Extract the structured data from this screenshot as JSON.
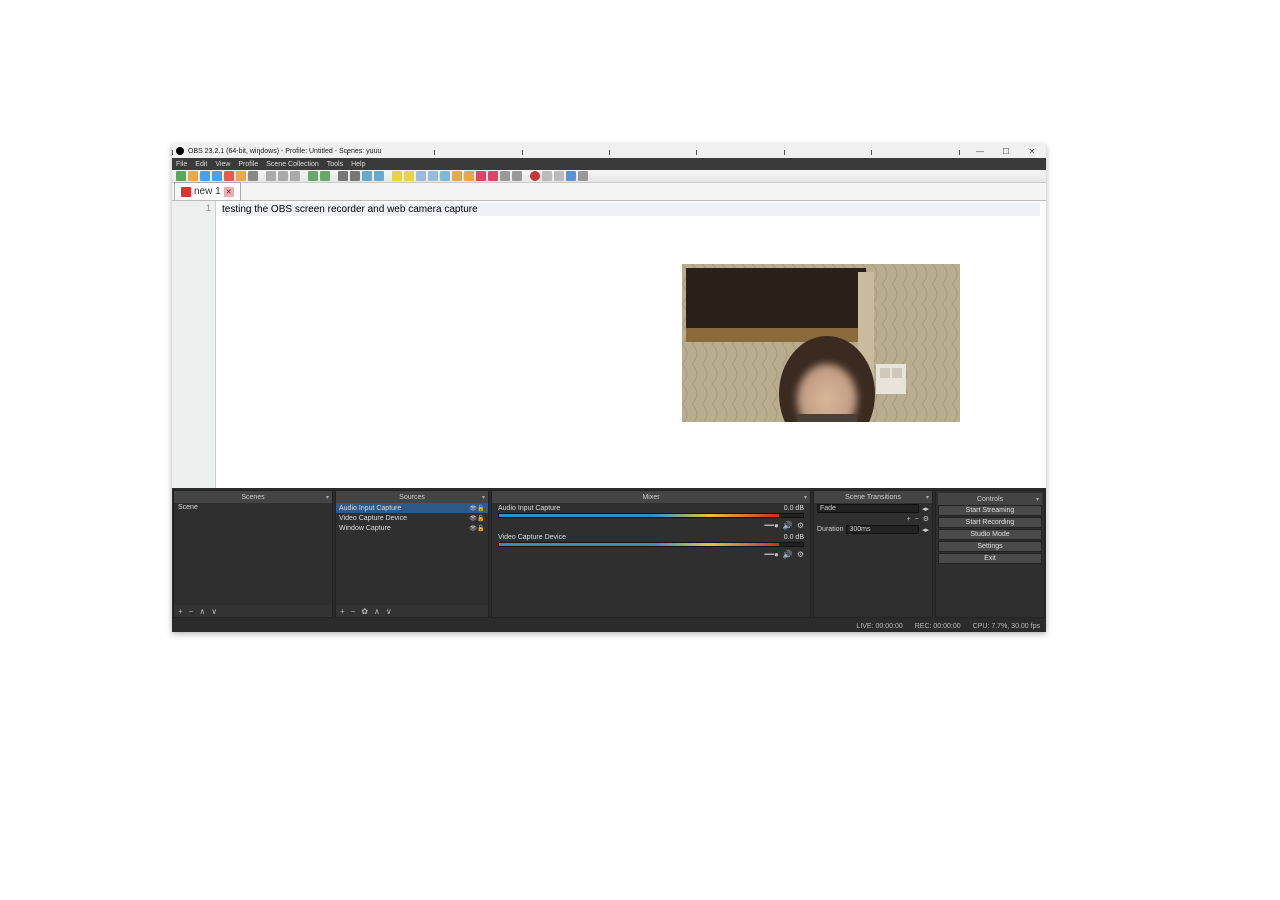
{
  "titlebar": {
    "title": "OBS 23.2.1 (64-bit, windows) - Profile: Untitled - Scenes: yuuu"
  },
  "menus": [
    "File",
    "Edit",
    "View",
    "Profile",
    "Scene Collection",
    "Tools",
    "Help"
  ],
  "editor": {
    "tab_name": "new 1",
    "line_number": "1",
    "line_text": "testing the OBS screen recorder and web camera capture"
  },
  "docks": {
    "scenes": {
      "header": "Scenes",
      "items": [
        "Scene"
      ]
    },
    "sources": {
      "header": "Sources",
      "items": [
        {
          "name": "Audio Input Capture",
          "selected": true
        },
        {
          "name": "Video Capture Device",
          "selected": false
        },
        {
          "name": "Window Capture",
          "selected": false
        }
      ]
    },
    "mixer": {
      "header": "Mixer",
      "channels": [
        {
          "name": "Audio Input Capture",
          "level": "0.0 dB"
        },
        {
          "name": "Video Capture Device",
          "level": "0.0 dB"
        }
      ]
    },
    "transitions": {
      "header": "Scene Transitions",
      "type": "Fade",
      "duration_label": "Duration",
      "duration_value": "300ms"
    },
    "controls": {
      "header": "Controls",
      "buttons": [
        "Start Streaming",
        "Start Recording",
        "Studio Mode",
        "Settings",
        "Exit"
      ]
    }
  },
  "statusbar": {
    "live": "LIVE: 00:00:00",
    "rec": "REC: 00:00:00",
    "cpu": "CPU: 7.7%, 30.00 fps"
  }
}
